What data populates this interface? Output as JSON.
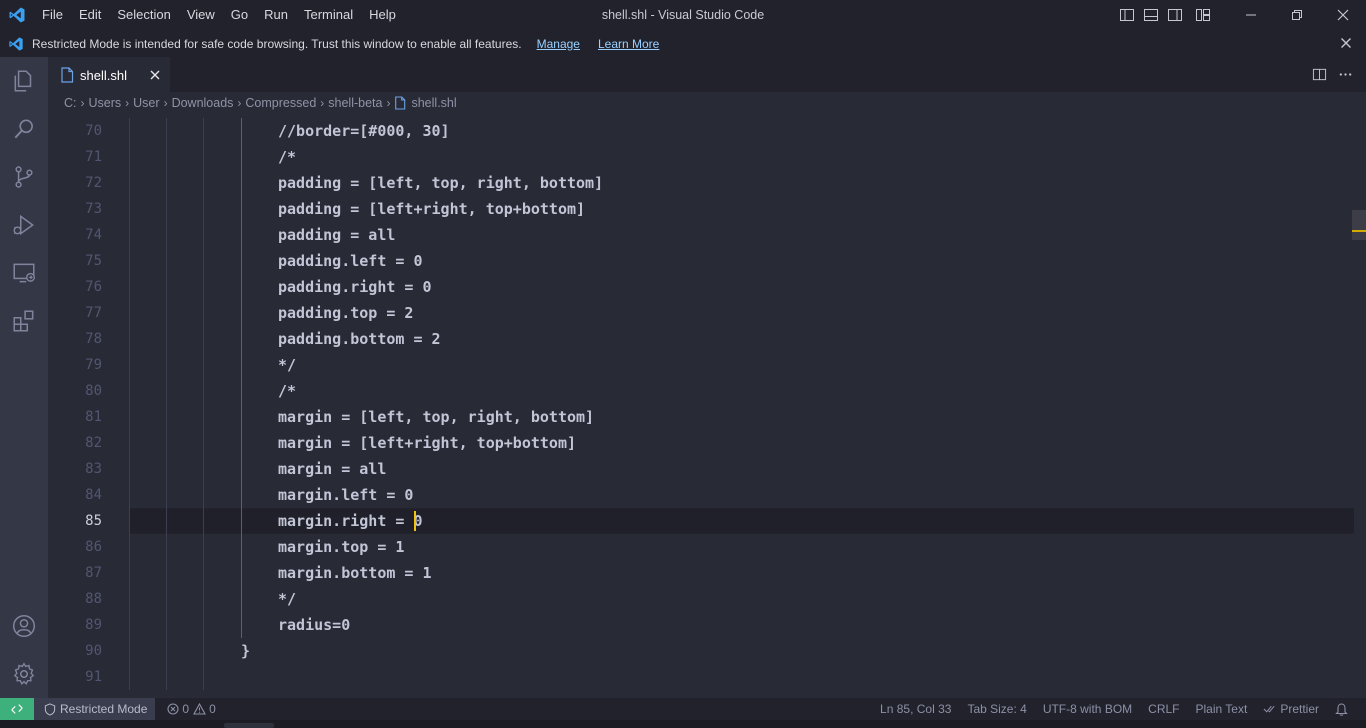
{
  "window": {
    "title": "shell.shl - Visual Studio Code"
  },
  "menu": [
    "File",
    "Edit",
    "Selection",
    "View",
    "Go",
    "Run",
    "Terminal",
    "Help"
  ],
  "banner": {
    "text": "Restricted Mode is intended for safe code browsing. Trust this window to enable all features.",
    "manage": "Manage",
    "learn_more": "Learn More"
  },
  "tab": {
    "label": "shell.shl"
  },
  "breadcrumb": [
    "C:",
    "Users",
    "User",
    "Downloads",
    "Compressed",
    "shell-beta",
    "shell.shl"
  ],
  "editor": {
    "active_line": 85,
    "lines": [
      {
        "n": "70",
        "text": "//border=[#000, 30]"
      },
      {
        "n": "71",
        "text": "/*"
      },
      {
        "n": "72",
        "text": "padding = [left, top, right, bottom]"
      },
      {
        "n": "73",
        "text": "padding = [left+right, top+bottom]"
      },
      {
        "n": "74",
        "text": "padding = all"
      },
      {
        "n": "75",
        "text": "padding.left = 0"
      },
      {
        "n": "76",
        "text": "padding.right = 0"
      },
      {
        "n": "77",
        "text": "padding.top = 2"
      },
      {
        "n": "78",
        "text": "padding.bottom = 2"
      },
      {
        "n": "79",
        "text": "*/"
      },
      {
        "n": "80",
        "text": "/*"
      },
      {
        "n": "81",
        "text": "margin = [left, top, right, bottom]"
      },
      {
        "n": "82",
        "text": "margin = [left+right, top+bottom]"
      },
      {
        "n": "83",
        "text": "margin = all"
      },
      {
        "n": "84",
        "text": "margin.left = 0"
      },
      {
        "n": "85",
        "text": "margin.right = 0"
      },
      {
        "n": "86",
        "text": "margin.top = 1"
      },
      {
        "n": "87",
        "text": "margin.bottom = 1"
      },
      {
        "n": "88",
        "text": "*/"
      },
      {
        "n": "89",
        "text": "radius=0"
      },
      {
        "n": "90",
        "text": "}"
      },
      {
        "n": "91",
        "text": ""
      }
    ]
  },
  "status": {
    "restricted": "Restricted Mode",
    "errors": "0",
    "warnings": "0",
    "position": "Ln 85, Col 33",
    "tab_size": "Tab Size: 4",
    "encoding": "UTF-8 with BOM",
    "eol": "CRLF",
    "language": "Plain Text",
    "prettier": "Prettier"
  },
  "colors": {
    "background": "#282a36",
    "chrome": "#21222c",
    "activity_bar": "#343746",
    "remote_indicator": "#3eb07b",
    "cursor": "#f1c40f",
    "link": "#9ad0ff"
  },
  "icons": {
    "activity": [
      "explorer-icon",
      "search-icon",
      "source-control-icon",
      "run-debug-icon",
      "remote-explorer-icon",
      "extensions-icon",
      "accounts-icon",
      "manage-gear-icon"
    ]
  }
}
